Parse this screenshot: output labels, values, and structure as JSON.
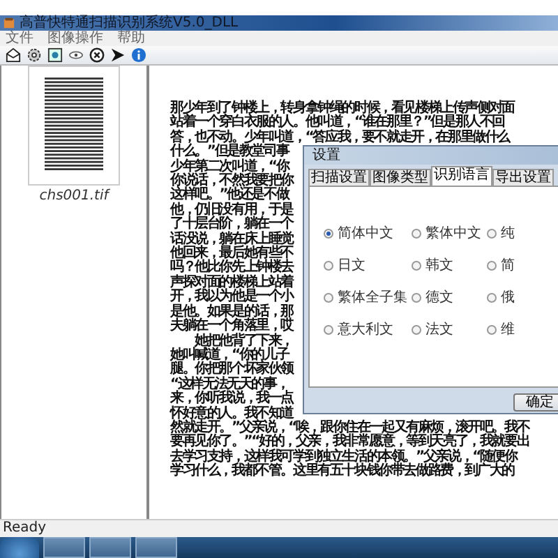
{
  "window": {
    "title": "高普快特通扫描识别系统V5.0_DLL"
  },
  "menu": [
    "文件",
    "图像操作",
    "帮助"
  ],
  "toolbar": [
    {
      "kind": "scan"
    },
    {
      "kind": "gear"
    },
    {
      "kind": "image"
    },
    {
      "kind": "eye"
    },
    {
      "kind": "stop"
    },
    {
      "kind": "arrow"
    },
    {
      "kind": "info"
    }
  ],
  "thumbnails": [
    {
      "label": "chs001.tif",
      "selected": false
    }
  ],
  "document": {
    "lines": [
      "那少年到了钟楼上，转身拿钟绳的时候，看见楼梯上传声侧对面",
      "站着一个穿白衣服的人。他叫道，“谁在那里？”但是那人不回",
      "答，也不动。少年叫道，“答应我，要不就走开，在那里做什么",
      "什么。”但是教堂司事",
      "少年第二次叫道，“你",
      "你说话，不然我要把你",
      "这样吧。”他还是不做",
      "他，仍旧没有用，于是",
      "了十层台阶，躺在一个",
      "话没说，躺在床上睡觉",
      "他回来，最后她有些不",
      "吗？他比你先上钟楼去",
      "声探对面的楼梯上站着",
      "开，我以为他是一个小",
      "是他。如果是的话，那",
      "夫躺在一个角落里，哎",
      "　　她把他背了下来，",
      "她叫喊道，“你的儿子",
      "腿。你把那个坏家伙领",
      "“这样无法无天的事，",
      "来，你听我说，我一点",
      "怀好意的人。我不知道",
      "然就走开。”父亲说，“唉，跟你住在一起又有麻烦，滚开吧。我不",
      "要再见你了。”“好的，父亲，我非常愿意，等到天亮了，我就要出",
      "去学习支持，这样我可学到独立生活的本领。”父亲说，“随便你",
      "学习什么，我都不管。这里有五十块钱你带去做路费，到广大的"
    ]
  },
  "dialog": {
    "title": "设置",
    "tabs": [
      {
        "label": "扫描设置",
        "selected": false
      },
      {
        "label": "图像类型",
        "selected": false
      },
      {
        "label": "识别语言",
        "selected": true
      },
      {
        "label": "导出设置",
        "selected": false
      }
    ],
    "options": [
      {
        "label": "简体中文",
        "selected": true
      },
      {
        "label": "繁体中文",
        "selected": false
      },
      {
        "label": "纯",
        "selected": false
      },
      {
        "label": "日文",
        "selected": false
      },
      {
        "label": "韩文",
        "selected": false
      },
      {
        "label": "简",
        "selected": false
      },
      {
        "label": "繁体全子集",
        "selected": false
      },
      {
        "label": "德文",
        "selected": false
      },
      {
        "label": "俄",
        "selected": false
      },
      {
        "label": "意大利文",
        "selected": false
      },
      {
        "label": "法文",
        "selected": false
      },
      {
        "label": "维",
        "selected": false
      }
    ],
    "buttons": [
      "确定"
    ]
  },
  "status_bar": "Ready"
}
